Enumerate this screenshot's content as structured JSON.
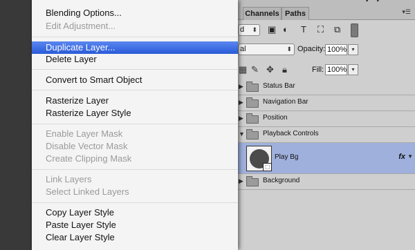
{
  "panel": {
    "tabs": {
      "channels": "Channels",
      "paths": "Paths"
    },
    "blend_mode_partial": "d",
    "kind_partial": "al",
    "opacity_label": "Opacity:",
    "opacity_value": "100%",
    "fill_label": "Fill:",
    "fill_value": "100%",
    "layers": [
      {
        "name": "Status Bar",
        "type": "group"
      },
      {
        "name": "Navigation Bar",
        "type": "group"
      },
      {
        "name": "Position",
        "type": "group"
      },
      {
        "name": "Playback Controls",
        "type": "group-open"
      },
      {
        "name": "Play Bg",
        "type": "layer",
        "selected": true,
        "fx": "fx"
      },
      {
        "name": "Background",
        "type": "group"
      }
    ]
  },
  "context_menu": {
    "items": [
      {
        "label": "Blending Options...",
        "enabled": true
      },
      {
        "label": "Edit Adjustment...",
        "enabled": false
      },
      {
        "label": "Duplicate Layer...",
        "enabled": true,
        "highlighted": true
      },
      {
        "label": "Delete Layer",
        "enabled": true
      },
      {
        "label": "Convert to Smart Object",
        "enabled": true
      },
      {
        "label": "Rasterize Layer",
        "enabled": true
      },
      {
        "label": "Rasterize Layer Style",
        "enabled": true
      },
      {
        "label": "Enable Layer Mask",
        "enabled": false
      },
      {
        "label": "Disable Vector Mask",
        "enabled": false
      },
      {
        "label": "Create Clipping Mask",
        "enabled": false
      },
      {
        "label": "Link Layers",
        "enabled": false
      },
      {
        "label": "Select Linked Layers",
        "enabled": false
      },
      {
        "label": "Copy Layer Style",
        "enabled": true
      },
      {
        "label": "Paste Layer Style",
        "enabled": true
      },
      {
        "label": "Clear Layer Style",
        "enabled": true
      }
    ]
  },
  "colors": {
    "menu_highlight": "#2a5bd8",
    "selected_layer": "#9fb0dc"
  }
}
